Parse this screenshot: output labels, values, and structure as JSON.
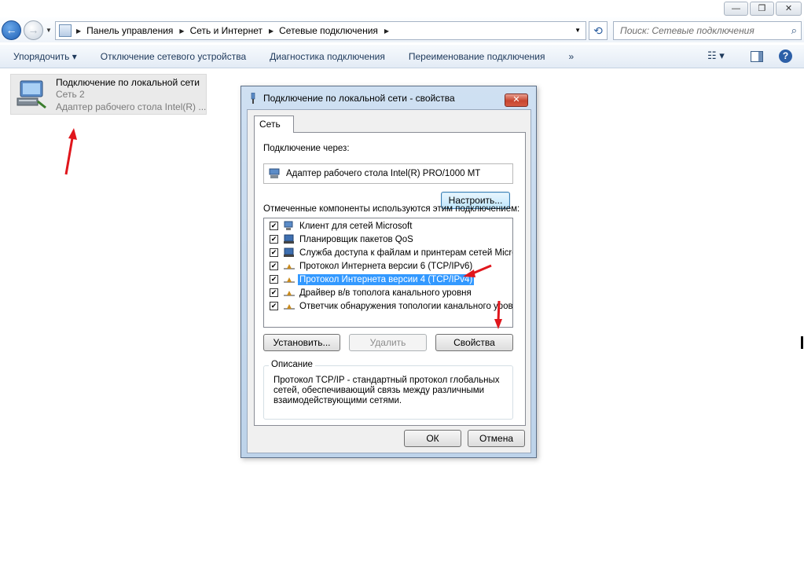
{
  "window": {
    "caption_buttons": [
      "—",
      "❐",
      "✕"
    ]
  },
  "address_bar": {
    "breadcrumbs": [
      "Панель управления",
      "Сеть и Интернет",
      "Сетевые подключения"
    ],
    "search_placeholder": "Поиск: Сетевые подключения"
  },
  "toolbar": {
    "organize": "Упорядочить ▾",
    "disable": "Отключение сетевого устройства",
    "diagnose": "Диагностика подключения",
    "rename": "Переименование подключения",
    "more": "»"
  },
  "connection": {
    "name": "Подключение по локальной сети",
    "network": "Сеть  2",
    "adapter": "Адаптер рабочего стола Intel(R) ..."
  },
  "dialog": {
    "title": "Подключение по локальной сети - свойства",
    "close": "✕",
    "tab": "Сеть",
    "connect_via_label": "Подключение через:",
    "adapter": "Адаптер рабочего стола Intel(R) PRO/1000 MT",
    "configure": "Настроить...",
    "components_label": "Отмеченные компоненты используются этим подключением:",
    "components": [
      {
        "label": "Клиент для сетей Microsoft",
        "checked": true,
        "icon": "client-icon"
      },
      {
        "label": "Планировщик пакетов QoS",
        "checked": true,
        "icon": "service-icon"
      },
      {
        "label": "Служба доступа к файлам и принтерам сетей Micro...",
        "checked": true,
        "icon": "service-icon"
      },
      {
        "label": "Протокол Интернета версии 6 (TCP/IPv6)",
        "checked": true,
        "icon": "protocol-icon"
      },
      {
        "label": "Протокол Интернета версии 4 (TCP/IPv4)",
        "checked": true,
        "icon": "protocol-icon",
        "selected": true
      },
      {
        "label": "Драйвер в/в тополога канального уровня",
        "checked": true,
        "icon": "protocol-icon"
      },
      {
        "label": "Ответчик обнаружения топологии канального уровня",
        "checked": true,
        "icon": "protocol-icon"
      }
    ],
    "install": "Установить...",
    "remove": "Удалить",
    "properties": "Свойства",
    "description_legend": "Описание",
    "description": "Протокол TCP/IP - стандартный протокол глобальных сетей, обеспечивающий связь между различными взаимодействующими сетями.",
    "ok": "ОК",
    "cancel": "Отмена"
  },
  "colors": {
    "selection": "#3399ff",
    "annotation_arrow": "#e0161c"
  }
}
